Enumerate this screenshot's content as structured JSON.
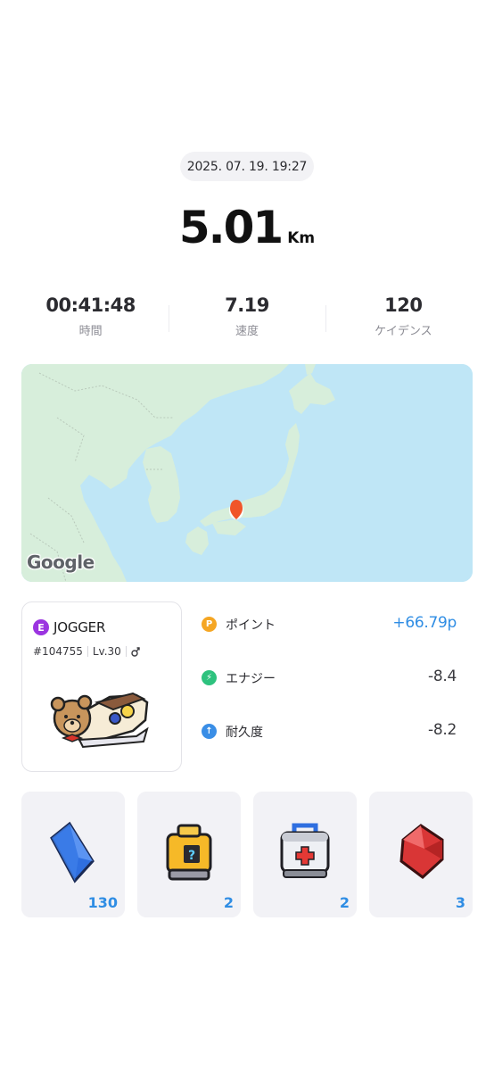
{
  "run": {
    "datetime": "2025. 07. 19. 19:27",
    "distance": "5.01",
    "distance_unit": "Km"
  },
  "stats": [
    {
      "value": "00:41:48",
      "label": "時間"
    },
    {
      "value": "7.19",
      "label": "速度"
    },
    {
      "value": "120",
      "label": "ケイデンス"
    }
  ],
  "map": {
    "provider_logo": "Google",
    "marker_color": "#f0552a"
  },
  "jogger": {
    "grade": "E",
    "grade_color": "#9b34e0",
    "type": "JOGGER",
    "id": "#104755",
    "level": "Lv.30",
    "gender_icon": "male-icon"
  },
  "rewards": [
    {
      "icon": "point-icon",
      "icon_glyph": "P",
      "color": "#f5a623",
      "label": "ポイント",
      "value": "+66.79p"
    },
    {
      "icon": "energy-icon",
      "icon_glyph": "⚡",
      "color": "#2ec27e",
      "label": "エナジー",
      "value": "-8.4"
    },
    {
      "icon": "durability-icon",
      "icon_glyph": "↑",
      "color": "#3a8ee6",
      "label": "耐久度",
      "value": "-8.2"
    }
  ],
  "items": [
    {
      "icon": "blue-crystal-icon",
      "count": "130"
    },
    {
      "icon": "mystery-box-icon",
      "count": "2"
    },
    {
      "icon": "first-aid-kit-icon",
      "count": "2"
    },
    {
      "icon": "red-gem-icon",
      "count": "3"
    }
  ],
  "colors": {
    "accent": "#2f8de4",
    "card_bg": "#f2f2f6"
  }
}
